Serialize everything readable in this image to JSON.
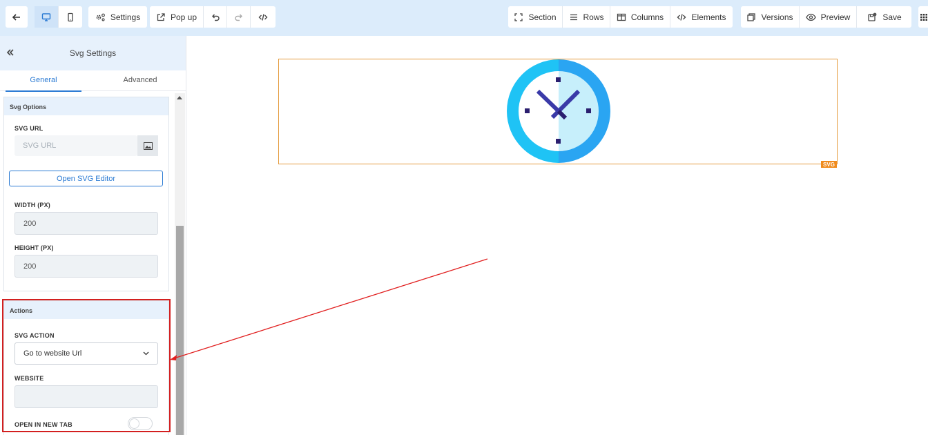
{
  "toolbar": {
    "settings_label": "Settings",
    "popup_label": "Pop up",
    "section_label": "Section",
    "rows_label": "Rows",
    "columns_label": "Columns",
    "elements_label": "Elements",
    "versions_label": "Versions",
    "preview_label": "Preview",
    "save_label": "Save"
  },
  "sidebar": {
    "title": "Svg Settings",
    "tabs": [
      "General",
      "Advanced"
    ],
    "svg_options": {
      "heading": "Svg Options",
      "url_label": "SVG URL",
      "url_placeholder": "SVG URL",
      "editor_button": "Open SVG Editor",
      "width_label": "WIDTH (PX)",
      "width_value": "200",
      "height_label": "HEIGHT (PX)",
      "height_value": "200"
    },
    "actions": {
      "heading": "Actions",
      "action_label": "SVG ACTION",
      "action_value": "Go to website Url",
      "website_label": "WEBSITE",
      "website_value": "",
      "new_tab_label": "OPEN IN NEW TAB",
      "new_tab_enabled": false
    }
  },
  "canvas": {
    "element_tag": "SVG",
    "icon": "clock-icon"
  },
  "colors": {
    "accent": "#2a7ad3",
    "highlight": "#d31f1f",
    "element_border": "#e49a3c"
  }
}
